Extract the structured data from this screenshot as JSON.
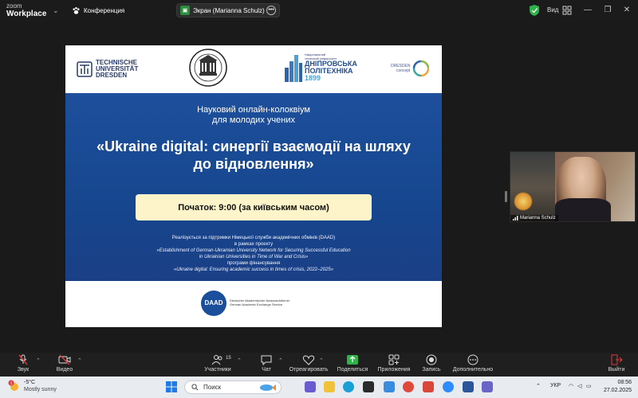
{
  "app": {
    "name_line1": "zoom",
    "name_line2": "Workplace"
  },
  "topbar": {
    "conference_label": "Конференция",
    "screen_label": "Экран (Marianna Schulz)",
    "view_label": "Вид"
  },
  "slide": {
    "tud_line1": "TECHNISCHE",
    "tud_line2": "UNIVERSITÄT",
    "tud_line3": "DRESDEN",
    "dpu_small1": "Національний",
    "dpu_small2": "технічний університет",
    "dpu_name1": "ДНІПРОВСЬКА",
    "dpu_name2": "ПОЛІТЕХНІКА",
    "dpu_year": "1899",
    "dresden_line1": "DRESDEN",
    "dresden_line2": "concept",
    "subtitle_line1": "Науковий онлайн-колоквіум",
    "subtitle_line2": "для молодих учених",
    "headline_line1": "«Ukraine digital: синергії взаємодії на шляху",
    "headline_line2": "до відновлення»",
    "start_text": "Початок: 9:00 (за київським часом)",
    "note1": "Реалізується за підтримки Німецької служби академічних обмінів (DAAD)",
    "note2": "в рамках проекту",
    "note3": "«Establishment of German-Ukrainian University Network for Securing Successful Education",
    "note4": "in Ukrainian Universities in Time of War and Crisis»",
    "note5": "програми фінансування",
    "note6": "«Ukraine digital: Ensuring academic success in times of crisis, 2022–2025»",
    "daad_logo": "DAAD",
    "daad_line1": "Deutscher Akademischer Austauschdienst",
    "daad_line2": "German Academic Exchange Service"
  },
  "participant": {
    "name": "Marianna Schulz"
  },
  "toolbar": {
    "audio": "Звук",
    "video": "Видео",
    "participants": "Участники",
    "participants_count": "15",
    "chat": "Чат",
    "react": "Отреагировать",
    "share": "Поделиться",
    "apps": "Приложения",
    "record": "Запись",
    "more": "Дополнительно",
    "leave": "Выйти"
  },
  "taskbar": {
    "temp": "-5°C",
    "weather": "Mostly sunny",
    "search_placeholder": "Поиск",
    "lang": "УКР",
    "time": "08:56",
    "date": "27.02.2025",
    "weather_badge": "1"
  }
}
